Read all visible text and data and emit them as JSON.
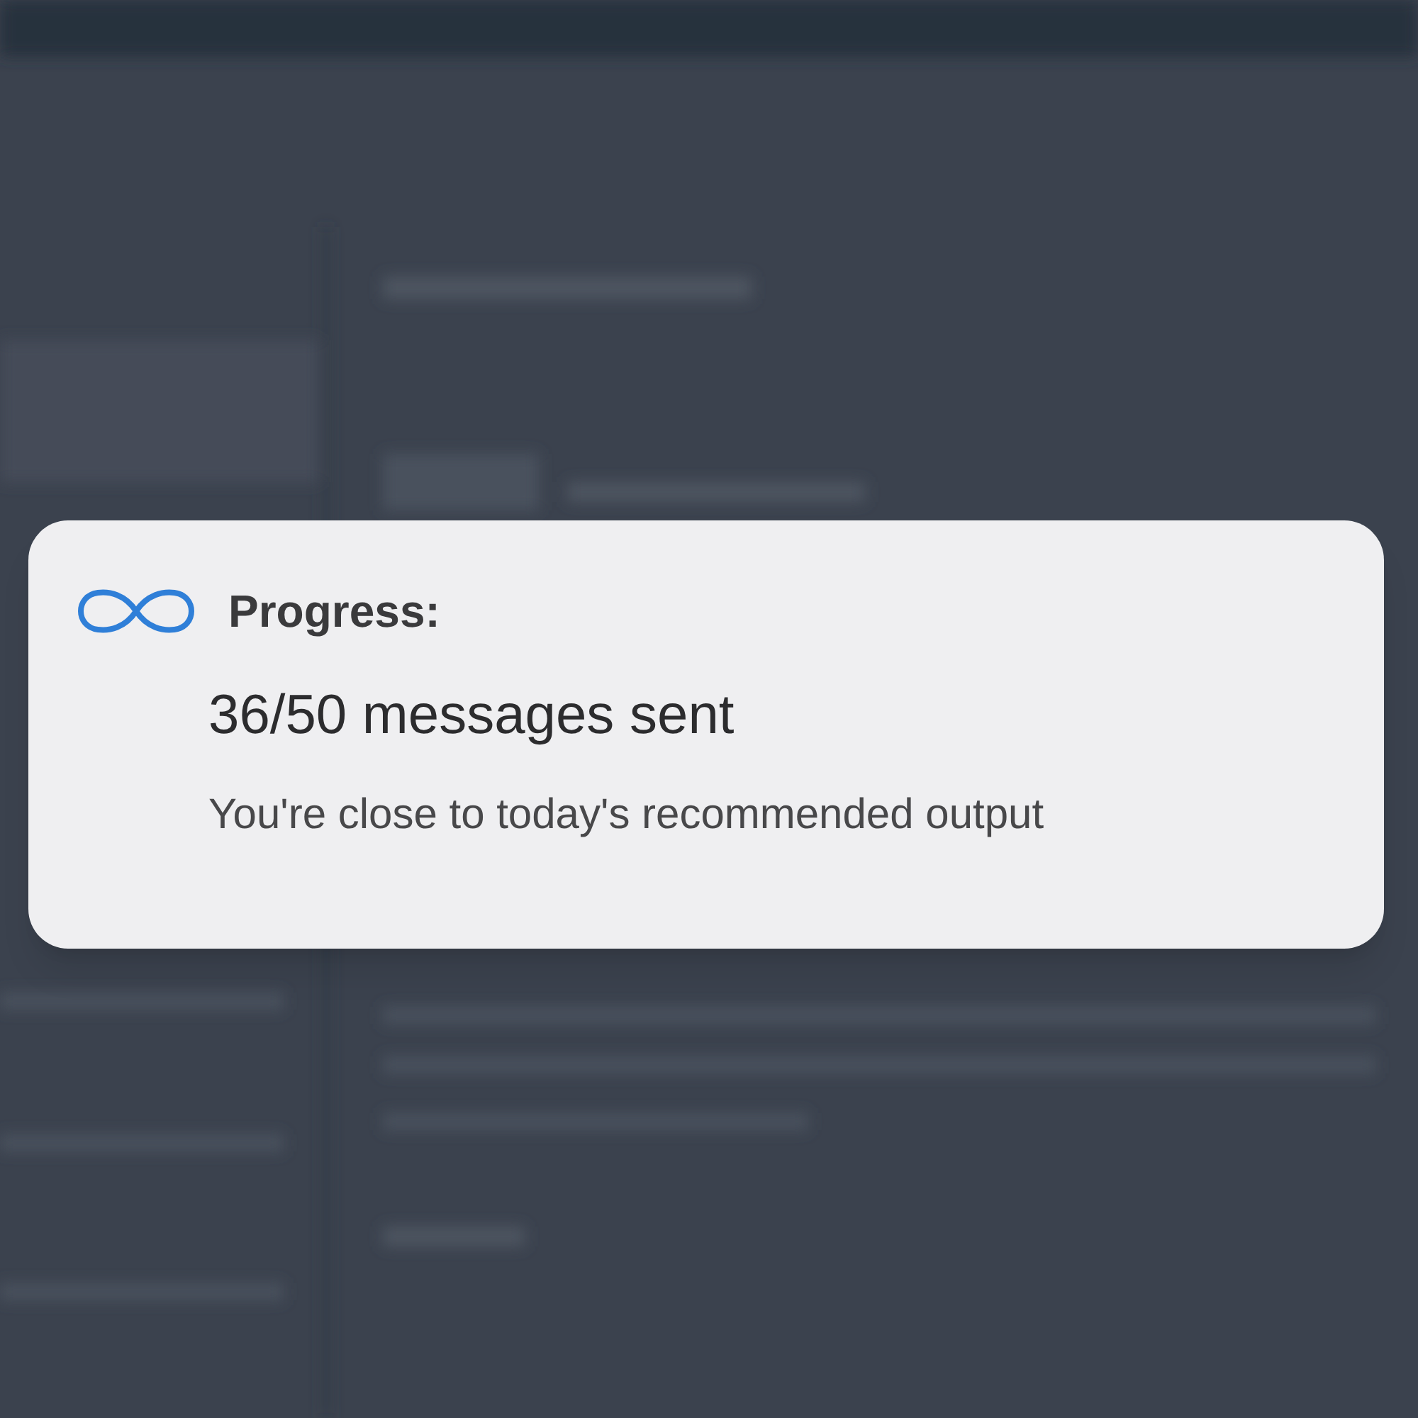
{
  "notification": {
    "title": "Progress:",
    "headline": "36/50 messages sent",
    "message": "You're close to today's recommended output"
  }
}
